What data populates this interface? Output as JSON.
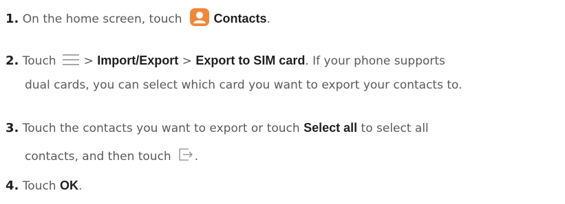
{
  "steps": [
    {
      "number": "1.",
      "text_a": "On the home screen, touch",
      "icon": "contacts-app-icon",
      "bold_a": "Contacts",
      "text_b": "."
    },
    {
      "number": "2.",
      "text_a": "Touch",
      "icon": "menu-icon",
      "sep_1": ">",
      "bold_a": "Import/Export",
      "sep_2": ">",
      "bold_b": "Export to SIM card",
      "text_b": ". If your phone supports",
      "text_c": "dual cards, you can select which card you want to export your contacts to."
    },
    {
      "number": "3.",
      "text_a": "Touch the contacts you want to export or touch",
      "bold_a": "Select all",
      "text_b": "to select all",
      "text_c": "contacts, and then touch",
      "icon": "export-icon",
      "text_d": "."
    },
    {
      "number": "4.",
      "text_a": "Touch",
      "bold_a": "OK",
      "text_b": "."
    }
  ],
  "colors": {
    "icon_orange": "#f0883a",
    "text": "#5a5a5a",
    "bold": "#1f1f1f",
    "icon_gray": "#8a8a8a"
  }
}
